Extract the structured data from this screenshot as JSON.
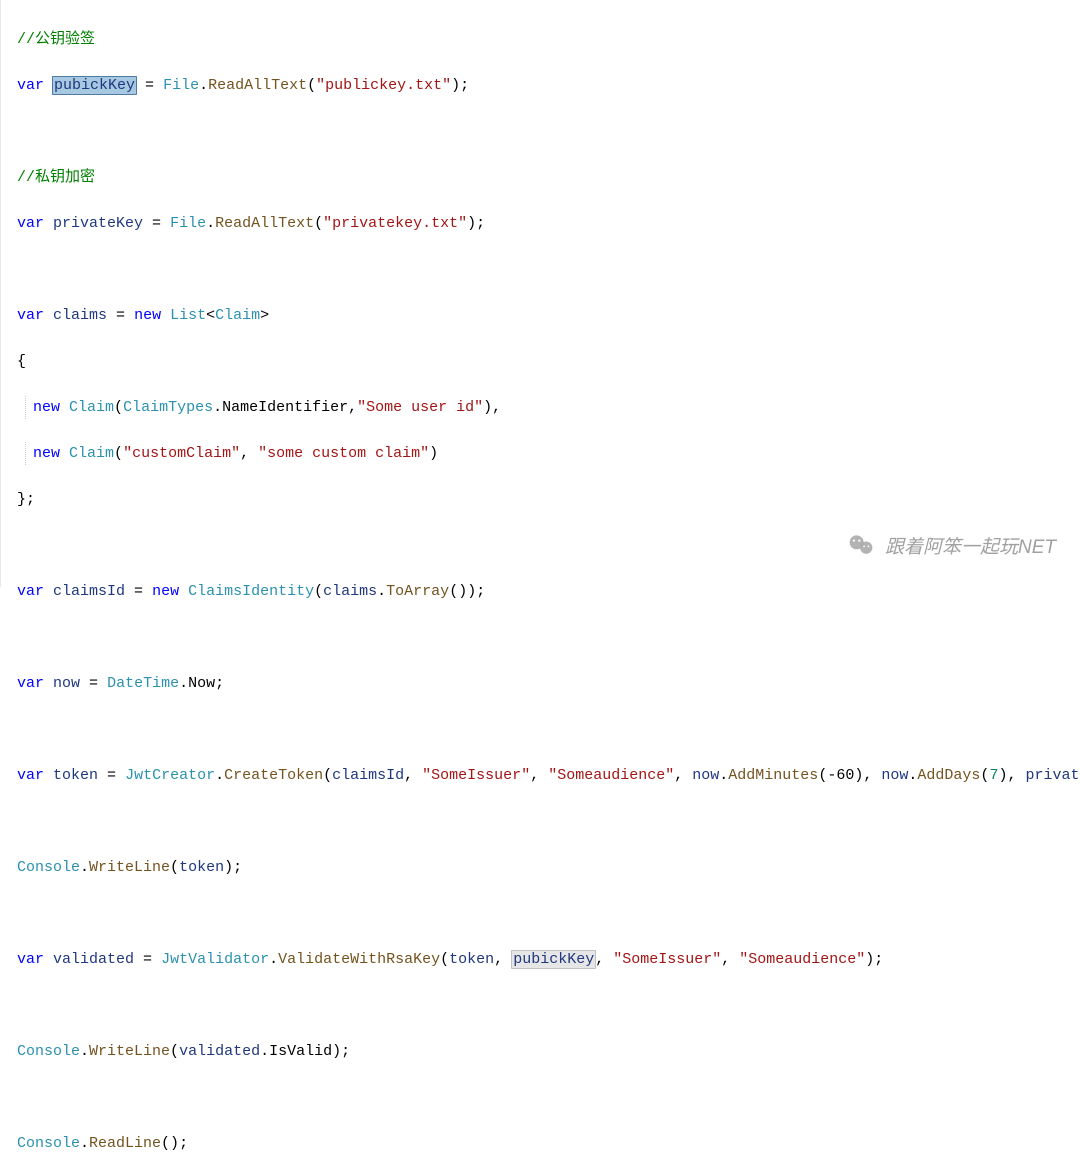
{
  "code": {
    "comment1": "//公钥验签",
    "line2": {
      "kw_var": "var",
      "ident": "pubickKey",
      "eq": " = ",
      "type": "File",
      "dot": ".",
      "method": "ReadAllText",
      "open": "(",
      "str": "\"publickey.txt\"",
      "close": ");"
    },
    "comment2": "//私钥加密",
    "line4": {
      "kw_var": "var",
      "ident": "privateKey",
      "eq": " = ",
      "type": "File",
      "dot": ".",
      "method": "ReadAllText",
      "open": "(",
      "str": "\"privatekey.txt\"",
      "close": ");"
    },
    "line_claims": {
      "kw_var": "var",
      "ident": "claims",
      "eq": " = ",
      "kw_new": "new",
      "sp": " ",
      "type": "List",
      "lt": "<",
      "type2": "Claim",
      "gt": ">"
    },
    "brace_open": "{",
    "line_claim1": {
      "kw_new": "new",
      "type": "Claim",
      "open": "(",
      "type2": "ClaimTypes",
      "dot": ".",
      "prop": "NameIdentifier",
      "comma": ",",
      "str": "\"Some user id\"",
      "close": "),"
    },
    "line_claim2": {
      "kw_new": "new",
      "type": "Claim",
      "open": "(",
      "str1": "\"customClaim\"",
      "comma": ", ",
      "str2": "\"some custom claim\"",
      "close": ")"
    },
    "brace_close": "};",
    "line_claimsid": {
      "kw_var": "var",
      "ident": "claimsId",
      "eq": " = ",
      "kw_new": "new",
      "sp": " ",
      "type": "ClaimsIdentity",
      "open": "(",
      "arg": "claims",
      "dot": ".",
      "method": "ToArray",
      "close": "());"
    },
    "line_now": {
      "kw_var": "var",
      "ident": "now",
      "eq": " = ",
      "type": "DateTime",
      "dot": ".",
      "prop": "Now",
      "semi": ";"
    },
    "line_token": {
      "kw_var": "var",
      "ident": "token",
      "eq": " = ",
      "type": "JwtCreator",
      "dot": ".",
      "method": "CreateToken",
      "open": "(",
      "arg1": "claimsId",
      "c1": ", ",
      "str1": "\"SomeIssuer\"",
      "c2": ", ",
      "str2": "\"Someaudience\"",
      "c3": ", ",
      "arg2": "now",
      "dot2": ".",
      "method2": "AddMinutes",
      "open2": "(",
      "num1": "-60",
      "close2": ")",
      "c4": ", ",
      "arg3": "now",
      "dot3": ".",
      "method3": "AddDays",
      "open3": "(",
      "num2": "7",
      "close3": ")",
      "c5": ", ",
      "arg4": "privateKey",
      "close": ");"
    },
    "line_cw1": {
      "type": "Console",
      "dot": ".",
      "method": "WriteLine",
      "open": "(",
      "arg": "token",
      "close": ");"
    },
    "line_validated": {
      "kw_var": "var",
      "ident": "validated",
      "eq": " = ",
      "type": "JwtValidator",
      "dot": ".",
      "method": "ValidateWithRsaKey",
      "open": "(",
      "arg1": "token",
      "c1": ", ",
      "arg2": "pubickKey",
      "c2": ", ",
      "str1": "\"SomeIssuer\"",
      "c3": ", ",
      "str2": "\"Someaudience\"",
      "close": ");"
    },
    "line_cw2": {
      "type": "Console",
      "dot": ".",
      "method": "WriteLine",
      "open": "(",
      "arg": "validated",
      "dot2": ".",
      "prop": "IsValid",
      "close": ");"
    },
    "line_readline": {
      "type": "Console",
      "dot": ".",
      "method": "ReadLine",
      "open": "()",
      "semi": ";"
    }
  },
  "watermark": {
    "text": "跟着阿笨一起玩NET"
  }
}
